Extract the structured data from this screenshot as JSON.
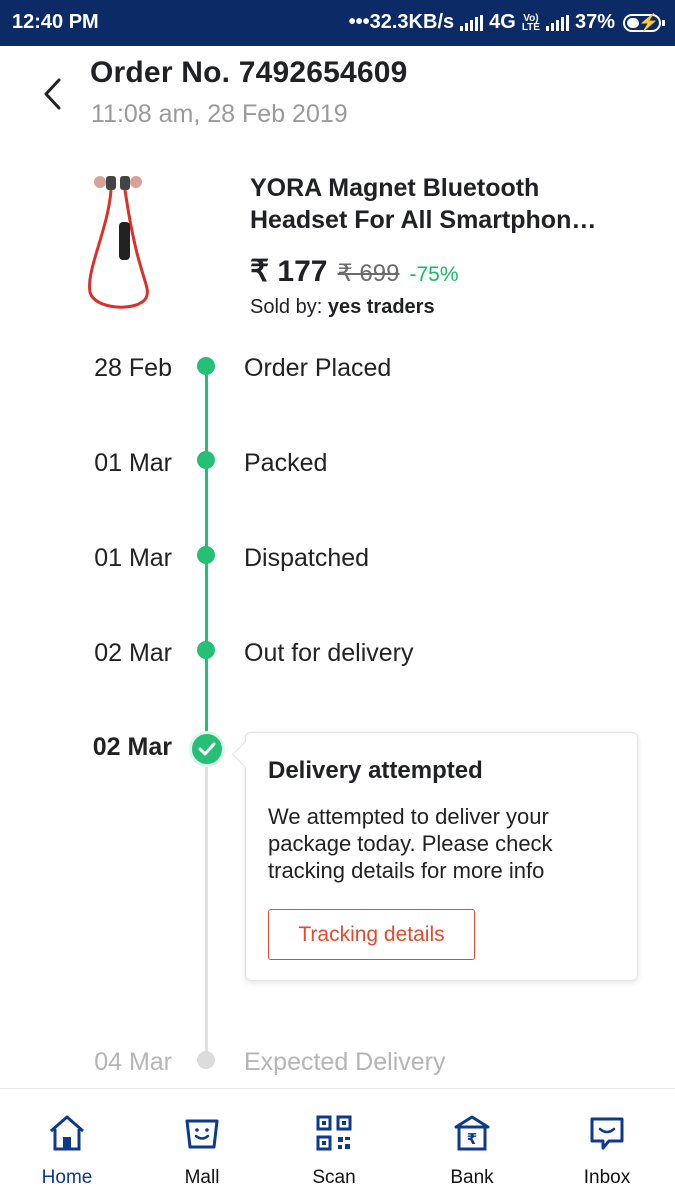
{
  "status_bar": {
    "time": "12:40 PM",
    "network_speed": "•••32.3KB/s",
    "network_type": "4G",
    "volte_top": "Vo)",
    "volte_bottom": "LTE",
    "battery": "37%"
  },
  "header": {
    "order_title": "Order No. 7492654609",
    "order_date": "11:08 am, 28 Feb 2019"
  },
  "product": {
    "name": "YORA Magnet Bluetooth Headset For All Smartphon…",
    "price": "₹ 177",
    "mrp": "₹ 699",
    "discount": "-75%",
    "sold_by_label": "Sold by:",
    "seller": "yes traders"
  },
  "timeline": [
    {
      "date": "28 Feb",
      "label": "Order Placed",
      "state": "done"
    },
    {
      "date": "01 Mar",
      "label": "Packed",
      "state": "done"
    },
    {
      "date": "01 Mar",
      "label": "Dispatched",
      "state": "done"
    },
    {
      "date": "02 Mar",
      "label": "Out for delivery",
      "state": "done"
    },
    {
      "date": "02 Mar",
      "label": "Delivery attempted",
      "state": "current"
    },
    {
      "date": "04 Mar",
      "label": "Expected Delivery",
      "state": "pending"
    }
  ],
  "attempt_card": {
    "title": "Delivery attempted",
    "message": "We attempted to deliver your package today. Please check tracking details for more info",
    "button": "Tracking details"
  },
  "bottom_nav": [
    {
      "label": "Home",
      "icon": "home-icon",
      "active": true
    },
    {
      "label": "Mall",
      "icon": "mall-bag-icon",
      "active": false
    },
    {
      "label": "Scan",
      "icon": "qr-scan-icon",
      "active": false
    },
    {
      "label": "Bank",
      "icon": "bank-icon",
      "active": false
    },
    {
      "label": "Inbox",
      "icon": "inbox-chat-icon",
      "active": false
    }
  ],
  "colors": {
    "status_bar": "#0b2a66",
    "timeline_done": "#26bf76",
    "discount": "#18b86a",
    "button_accent": "#e44a2f",
    "nav_active": "#0c3a8c"
  }
}
